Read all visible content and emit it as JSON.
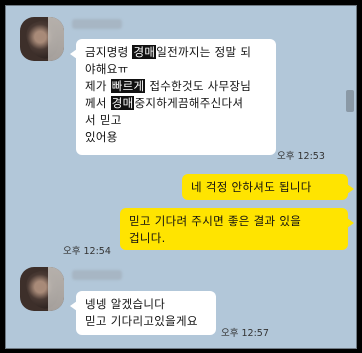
{
  "messages": [
    {
      "side": "left",
      "lines": [
        [
          {
            "t": "금지명령 "
          },
          {
            "t": "경매",
            "hl": true
          },
          {
            "t": "일전까지는 정말 되"
          }
        ],
        [
          {
            "t": "야해요ㅠ"
          }
        ],
        [
          {
            "t": "제가 "
          },
          {
            "t": "빠르게",
            "hl": true
          },
          {
            "t": " 접수한것도 사무장님"
          }
        ],
        [
          {
            "t": "께서 "
          },
          {
            "t": "경매",
            "hl": true
          },
          {
            "t": "중지하게끔해주신다셔"
          }
        ],
        [
          {
            "t": "서 믿고"
          }
        ],
        [
          {
            "t": "있어용"
          }
        ]
      ],
      "time": "오후 12:53"
    },
    {
      "side": "right",
      "lines": [
        [
          {
            "t": "네 걱정 안하셔도 됩니다"
          }
        ]
      ],
      "time": ""
    },
    {
      "side": "right",
      "lines": [
        [
          {
            "t": "믿고 기다려 주시면 좋은 결과 있을"
          }
        ],
        [
          {
            "t": "겁니다."
          }
        ]
      ],
      "time": "오후 12:54"
    },
    {
      "side": "left",
      "lines": [
        [
          {
            "t": "넹넹 알겠습니다"
          }
        ],
        [
          {
            "t": "믿고 기다리고있을게요"
          }
        ]
      ],
      "time": "오후 12:57"
    }
  ]
}
